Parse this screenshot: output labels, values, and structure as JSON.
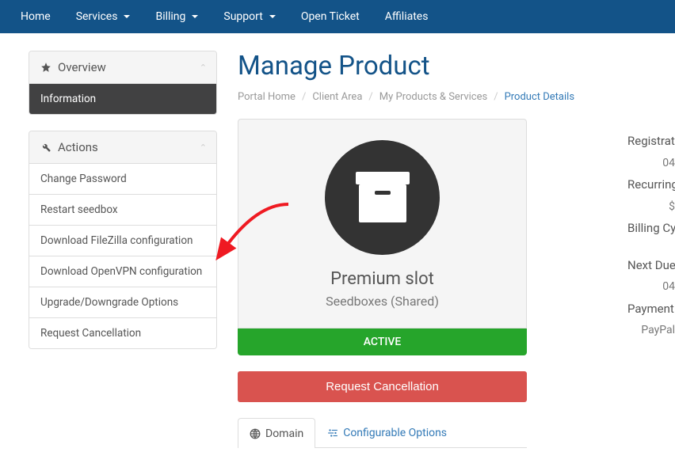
{
  "nav": {
    "home": "Home",
    "services": "Services",
    "billing": "Billing",
    "support": "Support",
    "open_ticket": "Open Ticket",
    "affiliates": "Affiliates"
  },
  "sidebar": {
    "overview": {
      "title": "Overview",
      "information": "Information"
    },
    "actions": {
      "title": "Actions",
      "change_password": "Change Password",
      "restart": "Restart seedbox",
      "filezilla": "Download FileZilla configuration",
      "openvpn": "Download OpenVPN configuration",
      "upgrade": "Upgrade/Downgrade Options",
      "cancel": "Request Cancellation"
    }
  },
  "page": {
    "title": "Manage Product",
    "breadcrumb": {
      "portal": "Portal Home",
      "client": "Client Area",
      "products": "My Products & Services",
      "details": "Product Details"
    }
  },
  "product": {
    "name": "Premium slot",
    "category": "Seedboxes (Shared)",
    "status": "ACTIVE",
    "cancel_btn": "Request Cancellation"
  },
  "tabs": {
    "domain": "Domain",
    "options": "Configurable Options"
  },
  "info": {
    "reg_label": "Registration Date",
    "reg_val": "04",
    "recur_label": "Recurring Amount",
    "recur_val": "$",
    "bill_label": "Billing Cycle",
    "next_label": "Next Due Date",
    "next_val": "04",
    "pay_label": "Payment Method",
    "pay_val": "PayPal"
  },
  "colors": {
    "brand": "#135388",
    "success": "#26a52b",
    "danger": "#d9534f",
    "link": "#337ab7",
    "arrow": "#ef1a22"
  }
}
